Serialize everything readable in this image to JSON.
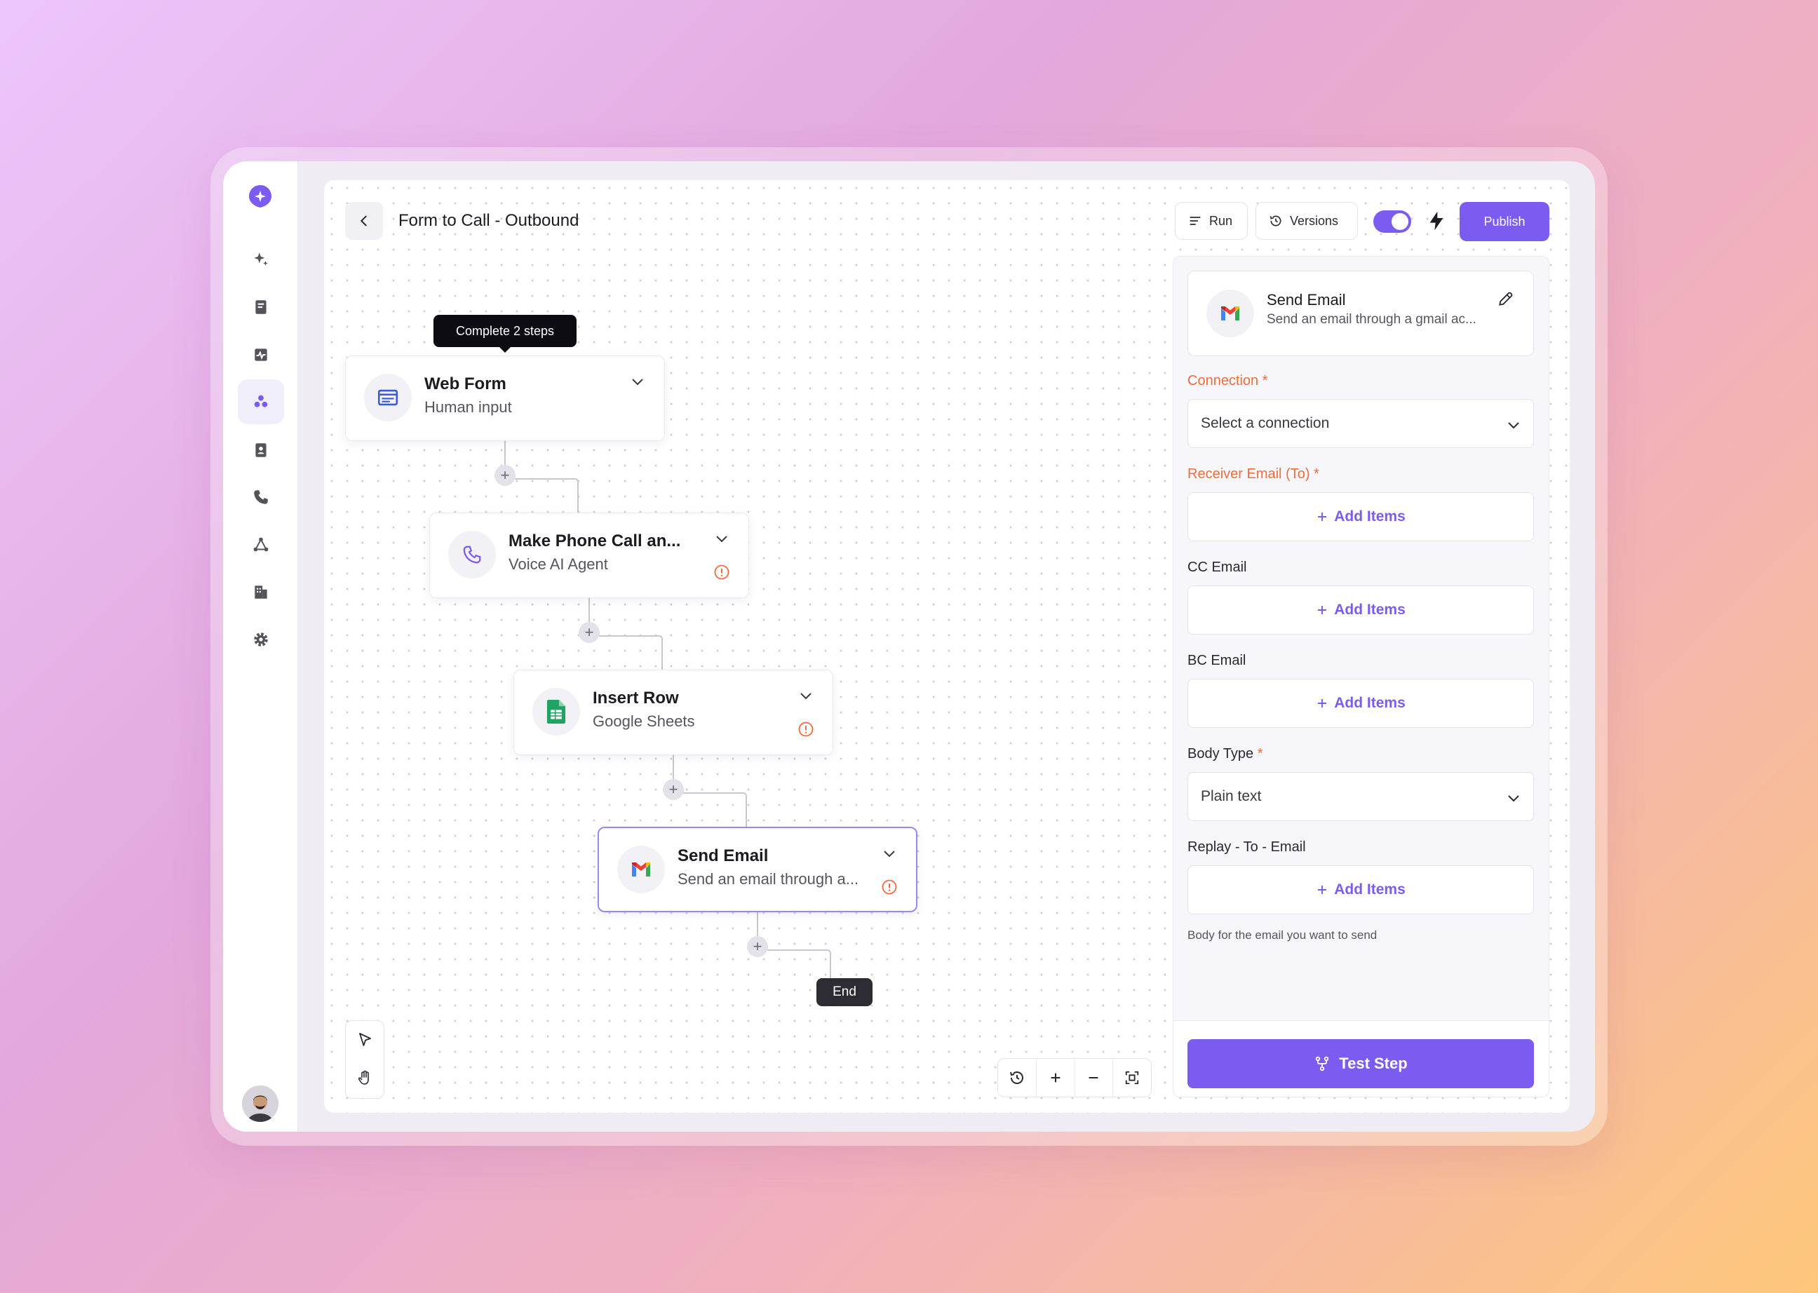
{
  "app": {
    "title": "Form to Call - Outbound"
  },
  "sidebar": {
    "items": [
      {
        "icon": "sparkle-icon"
      },
      {
        "icon": "book-icon"
      },
      {
        "icon": "activity-icon"
      },
      {
        "icon": "workflows-icon",
        "active": true
      },
      {
        "icon": "contacts-icon"
      },
      {
        "icon": "phone-icon"
      },
      {
        "icon": "integrations-icon"
      },
      {
        "icon": "building-icon"
      },
      {
        "icon": "gear-icon"
      }
    ]
  },
  "toolbar": {
    "run_label": "Run",
    "versions_label": "Versions",
    "publish_label": "Publish",
    "toggle_on": true
  },
  "flow": {
    "tooltip": "Complete 2 steps",
    "nodes": [
      {
        "title": "Web Form",
        "subtitle": "Human input",
        "icon": "web-form-icon",
        "warning": false
      },
      {
        "title": "Make Phone Call an...",
        "subtitle": "Voice AI Agent",
        "icon": "phone-icon",
        "warning": true
      },
      {
        "title": "Insert Row",
        "subtitle": "Google Sheets",
        "icon": "google-sheets-icon",
        "warning": true
      },
      {
        "title": "Send Email",
        "subtitle": "Send an email through a...",
        "icon": "gmail-icon",
        "warning": true,
        "selected": true
      }
    ],
    "end_label": "End"
  },
  "panel": {
    "step_title": "Send Email",
    "step_subtitle": "Send an email through a gmail ac...",
    "fields": {
      "connection_label": "Connection",
      "connection_placeholder": "Select a connection",
      "receiver_label": "Receiver Email (To)",
      "cc_label": "CC Email",
      "bc_label": "BC Email",
      "body_type_label": "Body Type",
      "body_type_value": "Plain text",
      "replay_label": "Replay - To - Email",
      "add_items_label": "Add Items",
      "required_mark": "*"
    },
    "hint": "Body for the email you want to send",
    "test_step_label": "Test Step"
  },
  "colors": {
    "accent": "#7c5cf0",
    "error": "#ef6c3c"
  }
}
